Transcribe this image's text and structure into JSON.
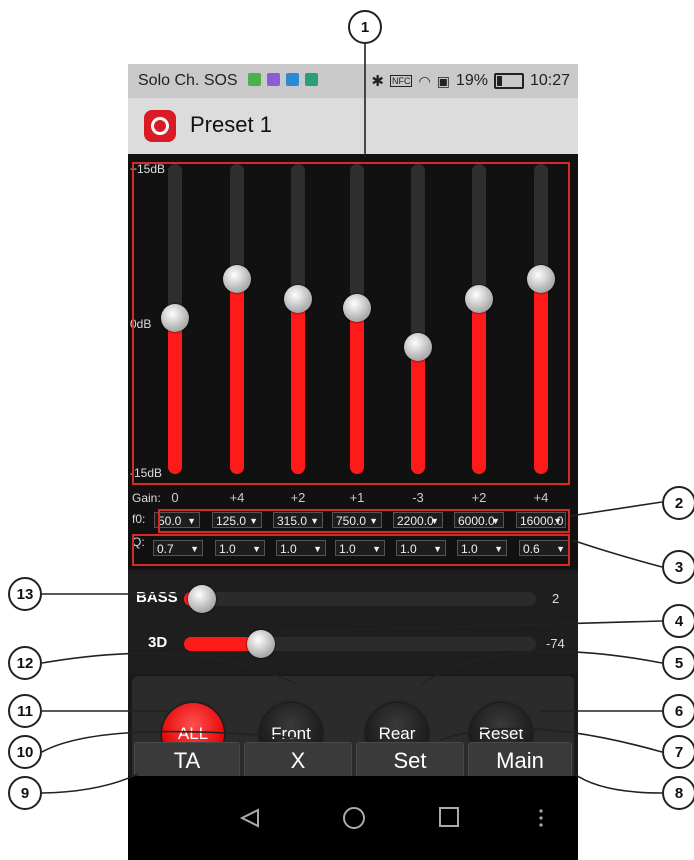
{
  "status_bar": {
    "carrier": "Solo Ch. SOS",
    "bluetooth_icon": "bluetooth-icon",
    "nfc_label": "NFC",
    "battery": "19%",
    "time": "10:27"
  },
  "app_bar": {
    "title": "Preset 1",
    "logo_icon": "app-logo-icon"
  },
  "eq": {
    "db_top": "+15dB",
    "db_mid": "0dB",
    "db_bottom": "-15dB",
    "gain_label": "Gain:",
    "f0_label": "f0:",
    "q_label": "Q:",
    "bands": [
      {
        "gain": 0,
        "gain_text": "0",
        "f0": "50.0",
        "q": "0.7"
      },
      {
        "gain": 4,
        "gain_text": "+4",
        "f0": "125.0",
        "q": "1.0"
      },
      {
        "gain": 2,
        "gain_text": "+2",
        "f0": "315.0",
        "q": "1.0"
      },
      {
        "gain": 1,
        "gain_text": "+1",
        "f0": "750.0",
        "q": "1.0"
      },
      {
        "gain": -3,
        "gain_text": "-3",
        "f0": "2200.0",
        "q": "1.0"
      },
      {
        "gain": 2,
        "gain_text": "+2",
        "f0": "6000.0",
        "q": "1.0"
      },
      {
        "gain": 4,
        "gain_text": "+4",
        "f0": "16000.0",
        "q": "0.6"
      }
    ],
    "gain_range": [
      -15,
      15
    ]
  },
  "bass": {
    "label": "BASS",
    "value": "2",
    "fraction": 0.05
  },
  "three_d": {
    "label": "3D",
    "value": "-74",
    "fraction": 0.22
  },
  "channel_buttons": {
    "all": "ALL",
    "front": "Front",
    "rear": "Rear",
    "reset": "Reset"
  },
  "bottom_tabs": {
    "ta": "TA",
    "x": "X",
    "set": "Set",
    "main": "Main"
  },
  "nav": {
    "back": "back-icon",
    "home": "home-icon",
    "recents": "recents-icon",
    "menu": "menu-icon"
  },
  "callouts": [
    "1",
    "2",
    "3",
    "4",
    "5",
    "6",
    "7",
    "8",
    "9",
    "10",
    "11",
    "12",
    "13"
  ],
  "colors": {
    "accent": "#ff1a1a",
    "frame": "#d32a2a"
  }
}
